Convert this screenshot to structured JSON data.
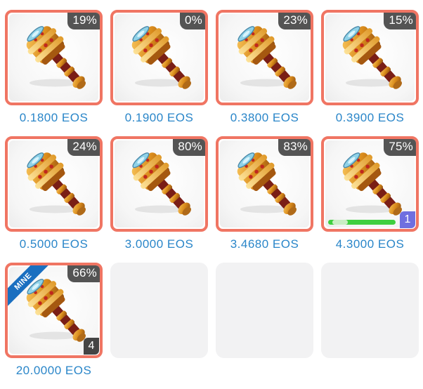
{
  "listings": [
    {
      "percent": "19%",
      "price": "0.1800 EOS"
    },
    {
      "percent": "0%",
      "price": "0.1900 EOS"
    },
    {
      "percent": "23%",
      "price": "0.3800 EOS"
    },
    {
      "percent": "15%",
      "price": "0.3900 EOS"
    },
    {
      "percent": "24%",
      "price": "0.5000 EOS"
    },
    {
      "percent": "80%",
      "price": "3.0000 EOS"
    },
    {
      "percent": "83%",
      "price": "3.4680 EOS"
    },
    {
      "percent": "75%",
      "price": "4.3000 EOS",
      "count": "1",
      "progress": 0.25
    },
    {
      "percent": "66%",
      "price": "20.0000 EOS",
      "count": "4",
      "ribbon": "MINE"
    }
  ],
  "empty_slots": 3,
  "item_icon": "golden-hammer-icon",
  "colors": {
    "card_border": "#f07563",
    "price_text": "#2a86c9",
    "badge_blue": "#6f6fe0",
    "badge_dark": "#444444",
    "progress_green": "#3fcf3f",
    "ribbon_blue": "#1a6fc0"
  }
}
